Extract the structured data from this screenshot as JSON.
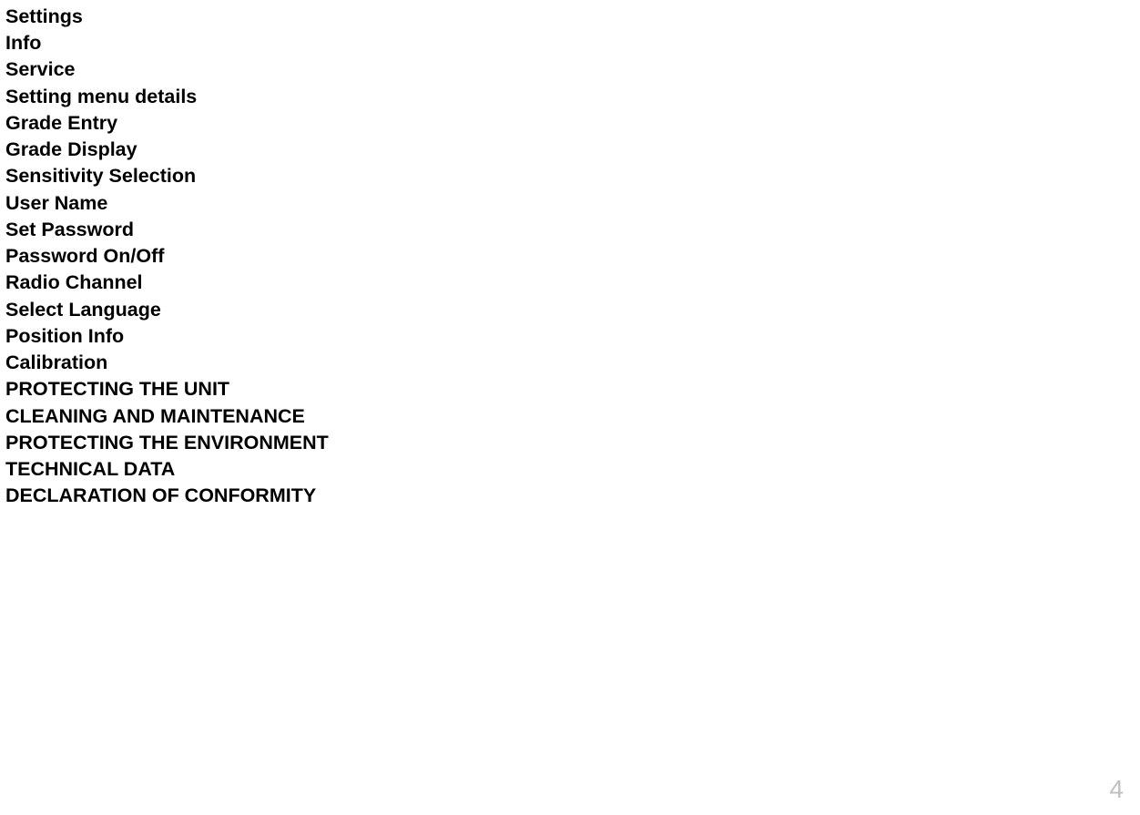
{
  "toc": {
    "items": [
      "Settings",
      "Info",
      "Service",
      "Setting menu details",
      "Grade Entry",
      "Grade Display",
      "Sensitivity Selection",
      "User Name",
      "Set Password",
      "Password On/Off",
      "Radio Channel",
      "Select Language",
      "Position Info",
      "Calibration",
      "PROTECTING THE UNIT",
      "CLEANING AND MAINTENANCE",
      "PROTECTING THE ENVIRONMENT",
      "TECHNICAL DATA",
      "DECLARATION OF CONFORMITY"
    ]
  },
  "page_number": "4"
}
